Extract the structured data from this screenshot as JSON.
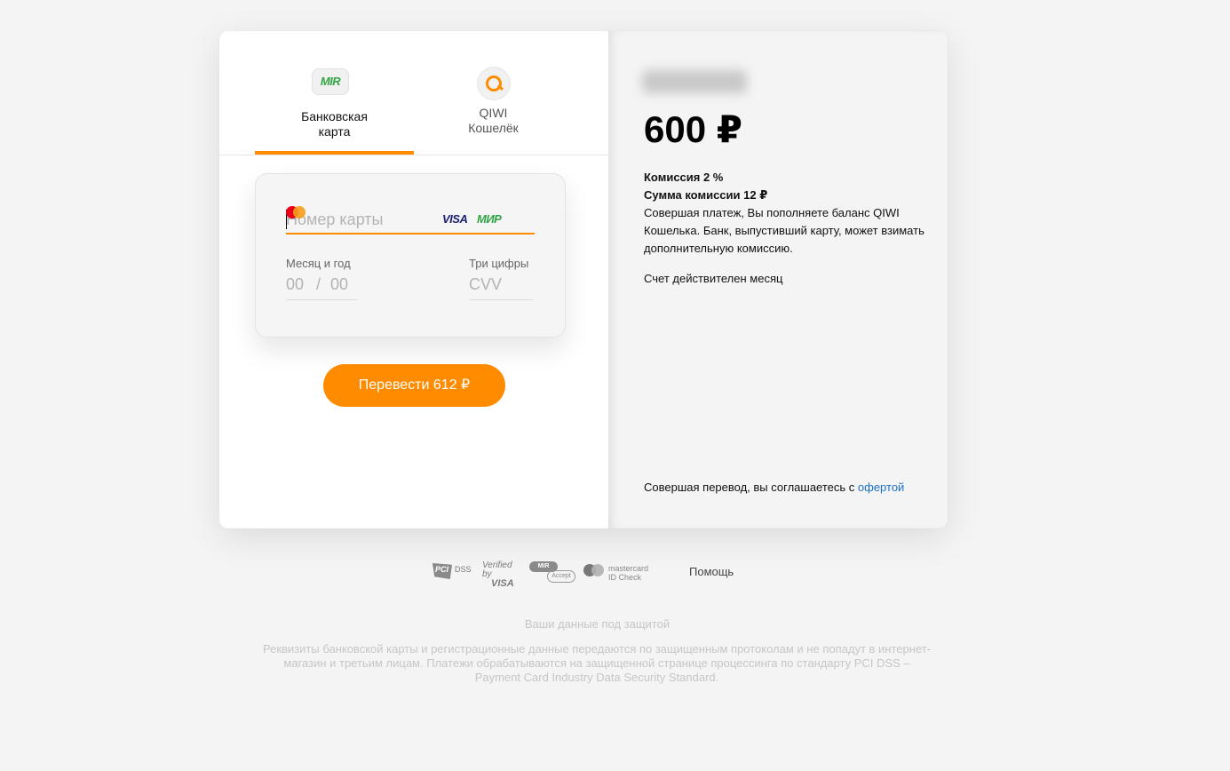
{
  "tabs": [
    {
      "label": "Банковская\nкарта",
      "icon_text": "MIR",
      "active": true
    },
    {
      "label": "QIWI\nКошелёк",
      "active": false
    }
  ],
  "card_form": {
    "number_placeholder": "Номер карты",
    "brands": [
      "VISA",
      "МИР",
      "mastercard"
    ],
    "exp_label": "Месяц и год",
    "exp_month": "00",
    "exp_sep": "/",
    "exp_year": "00",
    "cvv_label": "Три цифры",
    "cvv_placeholder": "CVV"
  },
  "pay_button": "Перевести 612 ₽",
  "summary": {
    "amount": "600 ₽",
    "commission": "Комиссия 2 %",
    "commission_sum": "Сумма комиссии 12 ₽",
    "note": "Совершая платеж, Вы пополняете баланс QIWI Кошелька. Банк, выпустивший карту, может взимать дополнительную комиссию.",
    "validity": "Счет действителен месяц",
    "offer_prefix": "Совершая перевод, вы соглашаетесь с ",
    "offer_link": "офертой"
  },
  "footer": {
    "badges": {
      "pci": "PCI",
      "pci_dss": "DSS",
      "visa_l1": "Verified by",
      "visa_l2": "VISA",
      "mir": "MIR",
      "mir_accept": "Accept",
      "mc_l1": "mastercard",
      "mc_l2": "ID Check"
    },
    "help": "Помощь",
    "secure_title": "Ваши данные под защитой",
    "secure_text": "Реквизиты банковской карты и регистрационные данные передаются по защищенным протоколам и не попадут в интернет-магазин и третьим лицам. Платежи обрабатываются на защищенной странице процессинга по стандарту PCI DSS – Payment Card Industry Data Security Standard."
  },
  "colors": {
    "accent": "#ff8c00",
    "link": "#1e6fc8"
  }
}
